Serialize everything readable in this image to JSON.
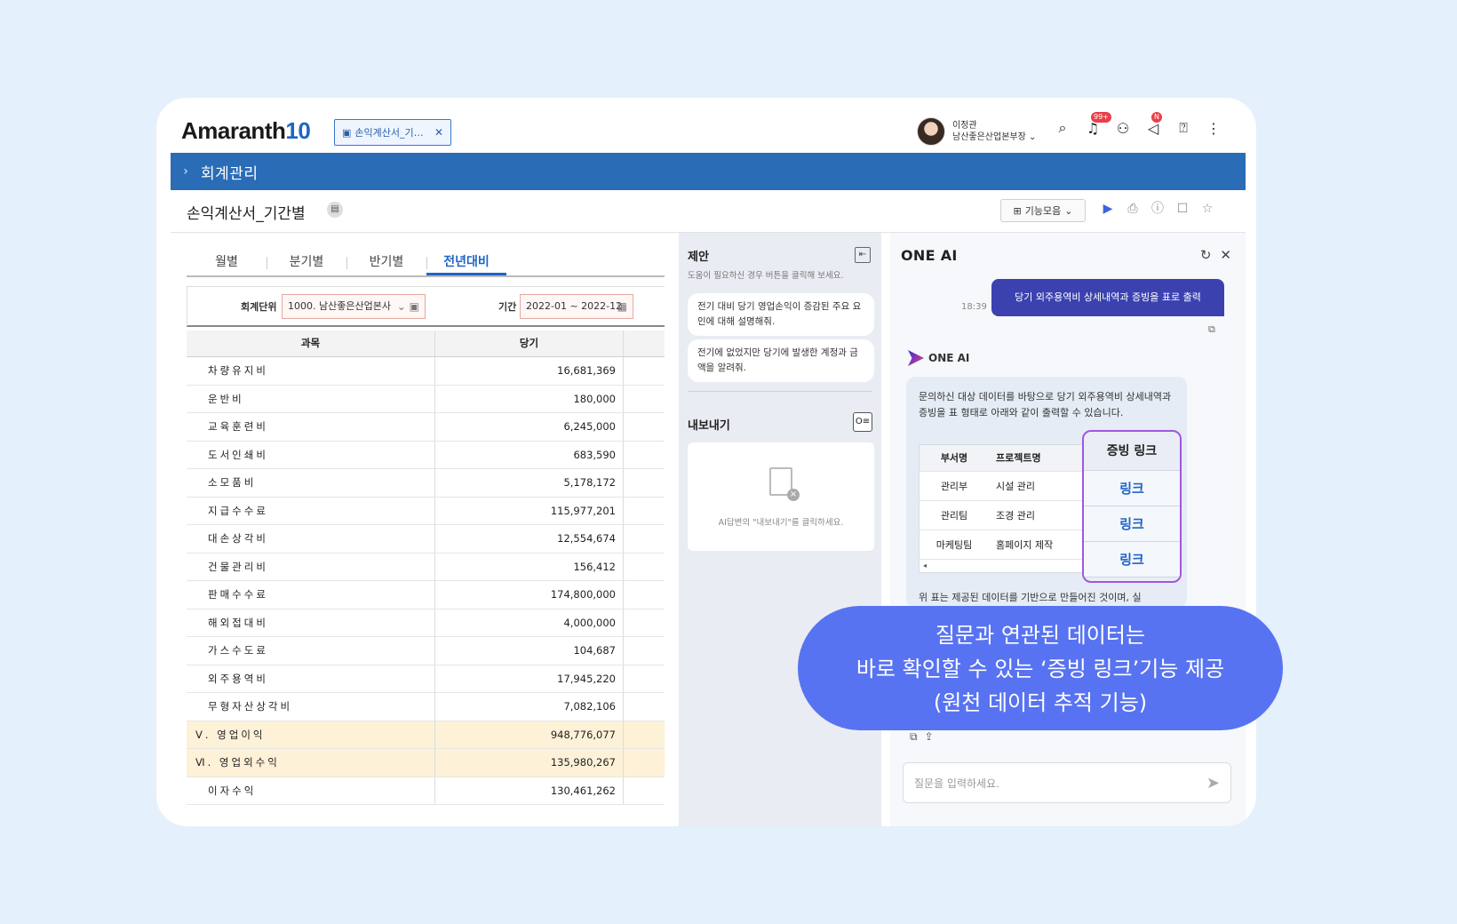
{
  "header": {
    "logo_text": "Amaranth",
    "logo_num": "10",
    "doc_tab_label": "손익계산서_기…",
    "user_name": "이정관",
    "user_dept": "남산좋은산업본부장",
    "notif_badge": "99+",
    "announce_badge": "N"
  },
  "module": {
    "title": "회계관리"
  },
  "page": {
    "title": "손익계산서_기간별",
    "feature_button": "기능모음"
  },
  "tabs": [
    "월별",
    "분기별",
    "반기별",
    "전년대비"
  ],
  "filters": {
    "unit_label": "회계단위",
    "unit_value": "1000. 남산좋은산업본사",
    "period_label": "기간",
    "period_value": "2022-01 ~ 2022-12"
  },
  "table": {
    "headers": [
      "과목",
      "당기"
    ],
    "rows": [
      {
        "name": "차량유지비",
        "value": "16,681,369"
      },
      {
        "name": "운반비",
        "value": "180,000"
      },
      {
        "name": "교육훈련비",
        "value": "6,245,000"
      },
      {
        "name": "도서인쇄비",
        "value": "683,590"
      },
      {
        "name": "소모품비",
        "value": "5,178,172"
      },
      {
        "name": "지급수수료",
        "value": "115,977,201"
      },
      {
        "name": "대손상각비",
        "value": "12,554,674"
      },
      {
        "name": "건물관리비",
        "value": "156,412"
      },
      {
        "name": "판매수수료",
        "value": "174,800,000"
      },
      {
        "name": "해외접대비",
        "value": "4,000,000"
      },
      {
        "name": "가스수도료",
        "value": "104,687"
      },
      {
        "name": "외주용역비",
        "value": "17,945,220"
      },
      {
        "name": "무형자산상각비",
        "value": "7,082,106"
      },
      {
        "name": "Ⅴ. 영업이익",
        "value": "948,776,077"
      },
      {
        "name": "Ⅵ. 영업외수익",
        "value": "135,980,267"
      },
      {
        "name": "이자수익",
        "value": "130,461,262"
      }
    ]
  },
  "suggest": {
    "title": "제안",
    "subtitle": "도움이 필요하신 경우 버튼을 클릭해 보세요.",
    "items": [
      "전기 대비 당기 영업손익이 증감된 주요 요인에 대해 설명해줘.",
      "전기에 없었지만 당기에 발생한 계정과 금액을 알려줘."
    ]
  },
  "export": {
    "title": "내보내기",
    "message": "AI답변의 \"내보내기\"를 클릭하세요."
  },
  "ai": {
    "title": "ONE AI",
    "brand": "ONE AI",
    "time": "18:39",
    "user_message": "당기 외주용역비 상세내역과 증빙을 표로 출력",
    "answer_intro": "문의하신 대상 데이터를 바탕으로 당기 외주용역비 상세내역과 증빙을 표 형태로 아래와 같이 출력할 수 있습니다.",
    "table_headers": [
      "부서명",
      "프로젝트명"
    ],
    "table_rows": [
      {
        "dept": "관리부",
        "project": "시설 관리"
      },
      {
        "dept": "관리팀",
        "project": "조경 관리"
      },
      {
        "dept": "마케팅팀",
        "project": "홈페이지 제작"
      }
    ],
    "evidence_header": "증빙 링크",
    "evidence_links": [
      "링크",
      "링크",
      "링크"
    ],
    "answer_tail": "위 표는 제공된 데이터를 기반으로 만들어진 것이며, 실",
    "input_placeholder": "질문을 입력하세요."
  },
  "callout": {
    "line1": "질문과 연관된 데이터는",
    "line2": "바로 확인할 수 있는 ‘증빙 링크’기능 제공",
    "line3": "(원천 데이터 추적 기능)"
  },
  "colors": {
    "brand_blue": "#2a6cb6",
    "callout": "#5873f1",
    "highlight": "#a057e0",
    "row_highlight": "#fdf1d8"
  }
}
